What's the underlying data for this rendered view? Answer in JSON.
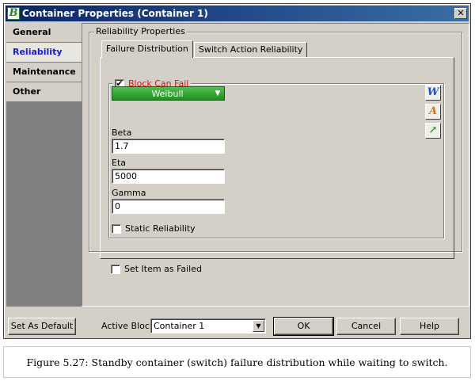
{
  "window": {
    "title": "Container Properties (Container 1)",
    "app_icon_letter": "B",
    "close_glyph": "✕"
  },
  "nav": {
    "items": [
      {
        "label": "General",
        "active": false
      },
      {
        "label": "Reliability",
        "active": true
      },
      {
        "label": "Maintenance",
        "active": false
      },
      {
        "label": "Other",
        "active": false
      }
    ]
  },
  "reliability": {
    "group_label": "Reliability Properties",
    "tabs": [
      {
        "label": "Failure Distribution",
        "active": true
      },
      {
        "label": "Switch Action Reliability",
        "active": false
      }
    ],
    "block_can_fail": {
      "label": "Block Can Fail",
      "checked": true,
      "label_color": "#e01010"
    },
    "distribution": {
      "value": "Weibull",
      "color": "#2fa82f"
    },
    "params": [
      {
        "label": "Beta",
        "value": "1.7"
      },
      {
        "label": "Eta",
        "value": "5000"
      },
      {
        "label": "Gamma",
        "value": "0"
      }
    ],
    "static_reliability": {
      "label": "Static Reliability",
      "checked": false
    },
    "set_failed": {
      "label": "Set Item as Failed",
      "checked": false
    },
    "side_icons": [
      {
        "name": "weibull-icon",
        "glyph": "W",
        "color": "#1a4fd0"
      },
      {
        "name": "analytical-icon",
        "glyph": "A",
        "color": "#e07010"
      },
      {
        "name": "plot-icon",
        "glyph": "↗",
        "color": "#2a9a2a"
      }
    ]
  },
  "footer": {
    "set_default_label": "Set As Default",
    "active_block_label": "Active Block:",
    "active_block_value": "Container 1",
    "ok_label": "OK",
    "cancel_label": "Cancel",
    "help_label": "Help"
  },
  "caption": "Figure 5.27: Standby container (switch) failure distribution while waiting to switch."
}
